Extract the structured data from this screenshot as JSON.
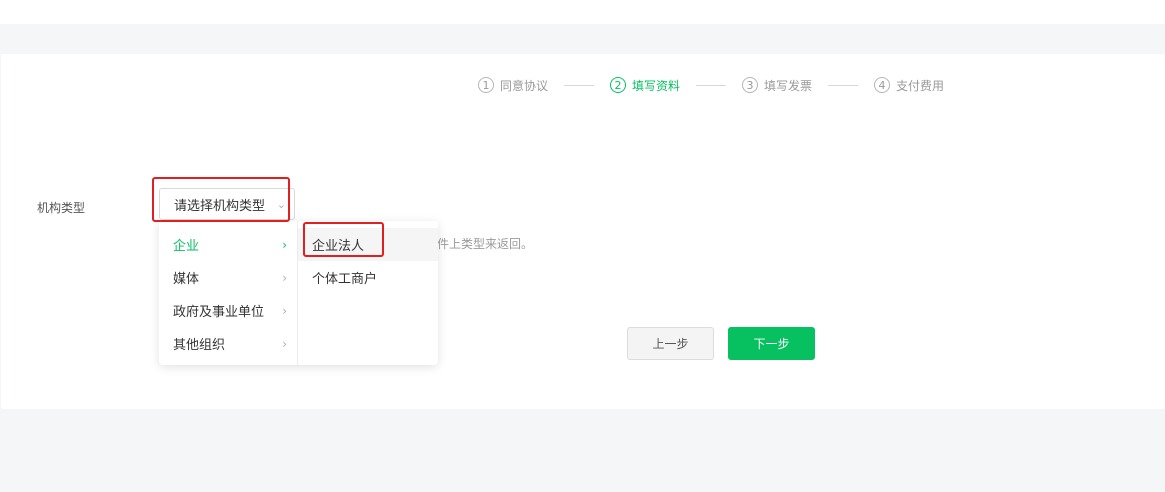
{
  "steps": [
    {
      "num": "1",
      "label": "同意协议"
    },
    {
      "num": "2",
      "label": "填写资料"
    },
    {
      "num": "3",
      "label": "填写发票"
    },
    {
      "num": "4",
      "label": "支付费用"
    }
  ],
  "form": {
    "org_type_label": "机构类型",
    "select_placeholder": "请选择机构类型",
    "hint_text": "件上类型来返回。"
  },
  "dropdown": {
    "level1": [
      "企业",
      "媒体",
      "政府及事业单位",
      "其他组织"
    ],
    "level2": [
      "企业法人",
      "个体工商户"
    ]
  },
  "buttons": {
    "prev": "上一步",
    "next": "下一步"
  },
  "colors": {
    "accent": "#07c160",
    "highlight": "#e02020"
  }
}
